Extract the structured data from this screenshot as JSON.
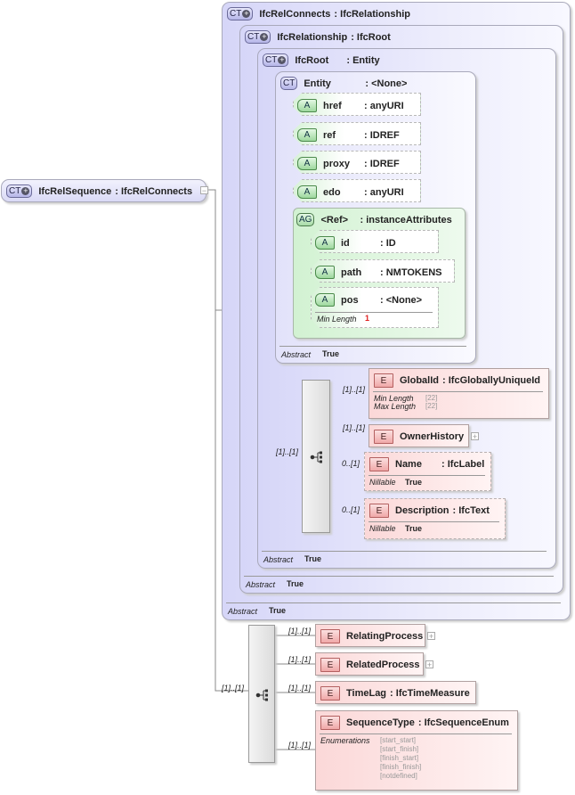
{
  "root": {
    "badge": "CT",
    "name": "IfcRelSequence",
    "type": "IfcRelConnects"
  },
  "complex_types": [
    {
      "badge": "CT",
      "name": "IfcRelConnects",
      "type": "IfcRelationship",
      "abstract_label": "Abstract",
      "abstract_value": "True"
    },
    {
      "badge": "CT",
      "name": "IfcRelationship",
      "type": "IfcRoot",
      "abstract_label": "Abstract",
      "abstract_value": "True"
    },
    {
      "badge": "CT",
      "name": "IfcRoot",
      "type": "Entity",
      "abstract_label": "Abstract",
      "abstract_value": "True"
    },
    {
      "badge": "CT",
      "name": "Entity",
      "type": "<None>",
      "abstract_label": "Abstract",
      "abstract_value": "True"
    }
  ],
  "attributes": [
    {
      "badge": "A",
      "name": "href",
      "type": "anyURI"
    },
    {
      "badge": "A",
      "name": "ref",
      "type": "IDREF"
    },
    {
      "badge": "A",
      "name": "proxy",
      "type": "IDREF"
    },
    {
      "badge": "A",
      "name": "edo",
      "type": "anyURI"
    }
  ],
  "attribute_group": {
    "badge": "AG",
    "name": "<Ref>",
    "type": "instanceAttributes",
    "attributes": [
      {
        "badge": "A",
        "name": "id",
        "type": "ID"
      },
      {
        "badge": "A",
        "name": "path",
        "type": "NMTOKENS"
      },
      {
        "badge": "A",
        "name": "pos",
        "type": "<None>",
        "prop_label": "Min Length",
        "prop_value": "1"
      }
    ]
  },
  "ifcroot_sequence": {
    "occurrence": "[1]..[1]",
    "elements": [
      {
        "badge": "E",
        "name": "GlobalId",
        "type": "IfcGloballyUniqueId",
        "occurrence": "[1]..[1]",
        "props": [
          {
            "label": "Min Length",
            "value": "[22]"
          },
          {
            "label": "Max Length",
            "value": "[22]"
          }
        ]
      },
      {
        "badge": "E",
        "name": "OwnerHistory",
        "occurrence": "[1]..[1]",
        "expandable": true
      },
      {
        "badge": "E",
        "name": "Name",
        "type": "IfcLabel",
        "occurrence": "0..[1]",
        "props": [
          {
            "label": "Nillable",
            "value": "True"
          }
        ]
      },
      {
        "badge": "E",
        "name": "Description",
        "type": "IfcText",
        "occurrence": "0..[1]",
        "props": [
          {
            "label": "Nillable",
            "value": "True"
          }
        ]
      }
    ]
  },
  "relsequence_sequence": {
    "occurrence": "[1]..[1]",
    "elements": [
      {
        "badge": "E",
        "name": "RelatingProcess",
        "occurrence": "[1]..[1]",
        "expandable": true
      },
      {
        "badge": "E",
        "name": "RelatedProcess",
        "occurrence": "[1]..[1]",
        "expandable": true
      },
      {
        "badge": "E",
        "name": "TimeLag",
        "type": "IfcTimeMeasure",
        "occurrence": "[1]..[1]"
      },
      {
        "badge": "E",
        "name": "SequenceType",
        "type": "IfcSequenceEnum",
        "occurrence": "[1]..[1]",
        "enum_label": "Enumerations",
        "enumerations": [
          "[start_start]",
          "[start_finish]",
          "[finish_start]",
          "[finish_finish]",
          "[notdefined]"
        ]
      }
    ]
  }
}
